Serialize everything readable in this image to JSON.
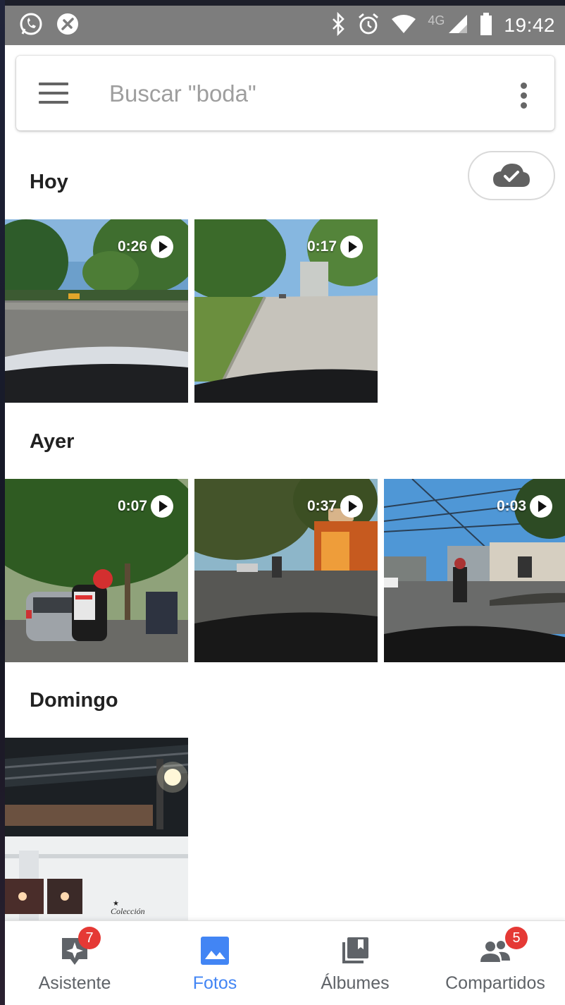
{
  "status_bar": {
    "time": "19:42",
    "network": "4G",
    "left_icons": [
      "whatsapp-icon",
      "no-data-icon"
    ],
    "right_icons": [
      "bluetooth-icon",
      "alarm-icon",
      "wifi-icon",
      "signal-icon",
      "battery-icon"
    ]
  },
  "search": {
    "placeholder": "Buscar \"boda\"",
    "menu_icon": "hamburger-menu-icon",
    "more_icon": "more-vertical-icon"
  },
  "backup": {
    "icon": "cloud-done-icon"
  },
  "sections": [
    {
      "title": "Hoy",
      "items": [
        {
          "duration": "0:26",
          "type": "video"
        },
        {
          "duration": "0:17",
          "type": "video"
        }
      ]
    },
    {
      "title": "Ayer",
      "items": [
        {
          "duration": "0:07",
          "type": "video"
        },
        {
          "duration": "0:37",
          "type": "video"
        },
        {
          "duration": "0:03",
          "type": "video"
        }
      ]
    },
    {
      "title": "Domingo",
      "items": [
        {
          "type": "photo",
          "caption": "Colección"
        }
      ]
    }
  ],
  "bottom_nav": {
    "items": [
      {
        "label": "Asistente",
        "icon": "assistant-icon",
        "badge": "7",
        "active": false
      },
      {
        "label": "Fotos",
        "icon": "photos-icon",
        "active": true
      },
      {
        "label": "Álbumes",
        "icon": "albums-icon",
        "active": false
      },
      {
        "label": "Compartidos",
        "icon": "shared-people-icon",
        "badge": "5",
        "active": false
      }
    ]
  },
  "colors": {
    "status_bar": "#7d7d7d",
    "accent": "#4285f4",
    "badge": "#e53935",
    "inactive_nav": "#5f6368"
  }
}
